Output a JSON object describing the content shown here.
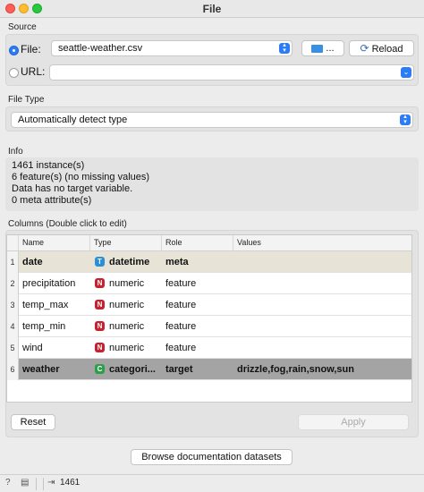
{
  "window": {
    "title": "File"
  },
  "source": {
    "section_label": "Source",
    "file_label": "File:",
    "file_value": "seattle-weather.csv",
    "browse_label": "...",
    "reload_label": "Reload",
    "url_label": "URL:",
    "url_value": ""
  },
  "file_type": {
    "section_label": "File Type",
    "value": "Automatically detect type"
  },
  "info": {
    "section_label": "Info",
    "lines": [
      "1461 instance(s)",
      "6 feature(s) (no missing values)",
      "Data has no target variable.",
      "0 meta attribute(s)"
    ]
  },
  "columns": {
    "section_label": "Columns (Double click to edit)",
    "headers": [
      "Name",
      "Type",
      "Role",
      "Values"
    ],
    "rows": [
      {
        "num": "1",
        "name": "date",
        "type_badge": "T",
        "type": "datetime",
        "role": "meta",
        "values": ""
      },
      {
        "num": "2",
        "name": "precipitation",
        "type_badge": "N",
        "type": "numeric",
        "role": "feature",
        "values": ""
      },
      {
        "num": "3",
        "name": "temp_max",
        "type_badge": "N",
        "type": "numeric",
        "role": "feature",
        "values": ""
      },
      {
        "num": "4",
        "name": "temp_min",
        "type_badge": "N",
        "type": "numeric",
        "role": "feature",
        "values": ""
      },
      {
        "num": "5",
        "name": "wind",
        "type_badge": "N",
        "type": "numeric",
        "role": "feature",
        "values": ""
      },
      {
        "num": "6",
        "name": "weather",
        "type_badge": "C",
        "type": "categori...",
        "role": "target",
        "values": "drizzle,fog,rain,snow,sun"
      }
    ],
    "reset_label": "Reset",
    "apply_label": "Apply"
  },
  "browse_datasets_label": "Browse documentation datasets",
  "statusbar": {
    "count": "1461"
  },
  "colors": {
    "datetime_badge": "#2b8fd6",
    "numeric_badge": "#c8202e",
    "categorical_badge": "#2e9e4a",
    "meta_row": "#e7e3d6",
    "target_row": "#a4a4a4",
    "accent": "#2b7cf6"
  }
}
